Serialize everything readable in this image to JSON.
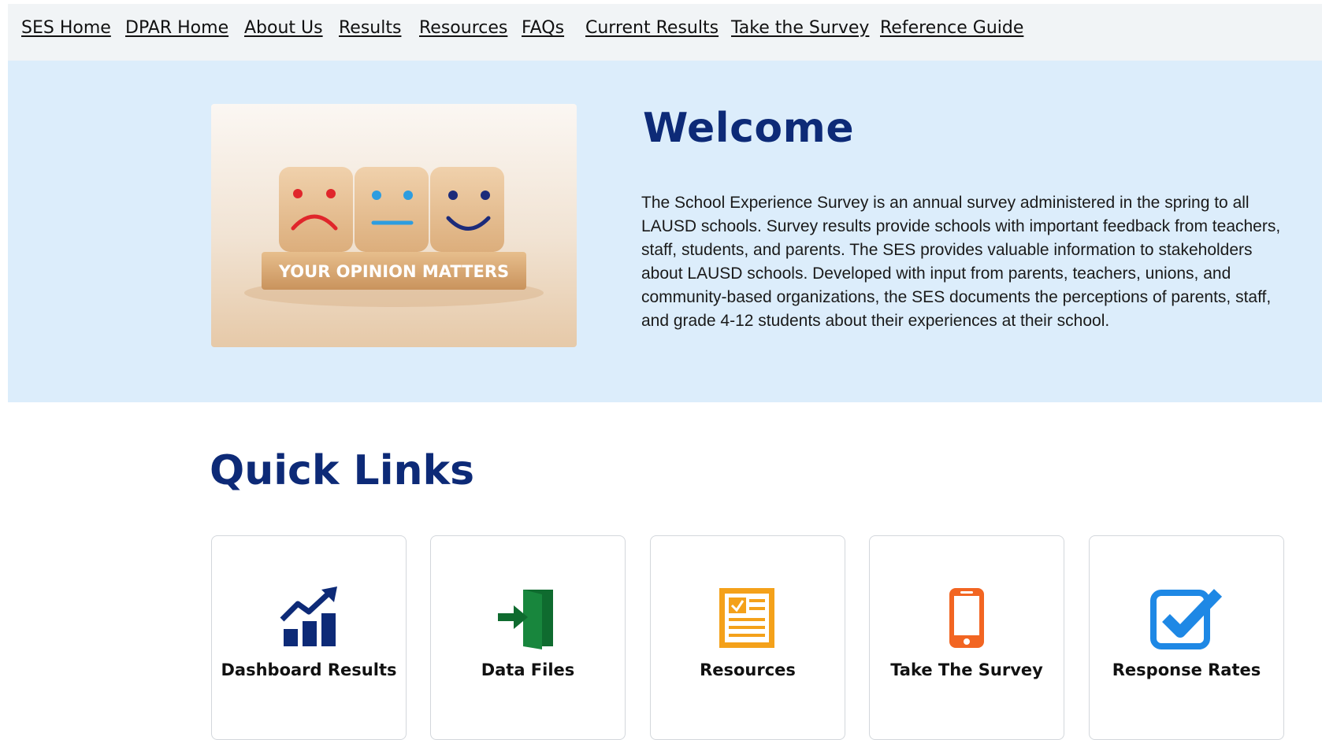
{
  "nav": {
    "items": [
      {
        "label": "SES Home"
      },
      {
        "label": "DPAR Home"
      },
      {
        "label": "About Us"
      },
      {
        "label": "Results"
      },
      {
        "label": "Resources"
      },
      {
        "label": "FAQs"
      },
      {
        "label": "Current Results"
      },
      {
        "label": "Take the Survey"
      },
      {
        "label": "Reference Guide"
      }
    ]
  },
  "hero": {
    "title": "Welcome",
    "image_caption": "YOUR OPINION MATTERS",
    "body": "The School Experience Survey is an annual survey administered in the spring to all LAUSD schools. Survey results provide schools with important feedback from teachers, staff, students, and parents. The SES provides valuable information to stakeholders about LAUSD schools. Developed with input from parents, teachers, unions, and community-based organizations, the SES documents the perceptions of parents, staff, and grade 4-12 students about their experiences at their school."
  },
  "quick_links": {
    "title": "Quick Links",
    "cards": [
      {
        "label": "Dashboard Results",
        "icon": "chart-growth-icon",
        "color": "#0d2a77"
      },
      {
        "label": "Data Files",
        "icon": "door-enter-icon",
        "color": "#0f6b2f"
      },
      {
        "label": "Resources",
        "icon": "document-checklist-icon",
        "color": "#f4a11a"
      },
      {
        "label": "Take The Survey",
        "icon": "mobile-phone-icon",
        "color": "#f26522"
      },
      {
        "label": "Response Rates",
        "icon": "checkbox-icon",
        "color": "#1e88e5"
      }
    ]
  },
  "colors": {
    "heading": "#0d2a77",
    "hero_bg": "#dcedfb",
    "nav_bg": "#f1f4f6"
  }
}
